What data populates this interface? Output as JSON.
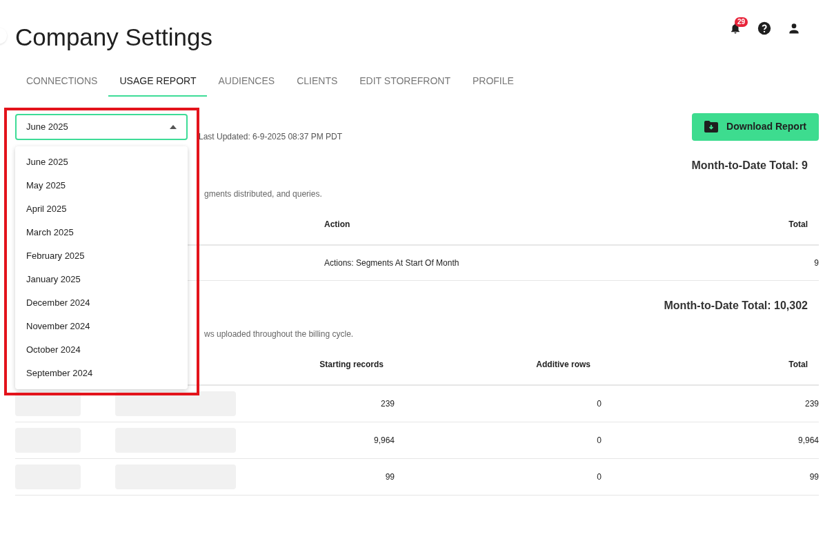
{
  "header": {
    "title": "Company Settings",
    "notifications": {
      "count": "29"
    }
  },
  "tabs": [
    {
      "label": "CONNECTIONS",
      "selected": false
    },
    {
      "label": "USAGE REPORT",
      "selected": true
    },
    {
      "label": "AUDIENCES",
      "selected": false
    },
    {
      "label": "CLIENTS",
      "selected": false
    },
    {
      "label": "EDIT STOREFRONT",
      "selected": false
    },
    {
      "label": "PROFILE",
      "selected": false
    }
  ],
  "month_select": {
    "value": "June 2025",
    "expanded": true,
    "options": [
      "June 2025",
      "May 2025",
      "April 2025",
      "March 2025",
      "February 2025",
      "January 2025",
      "December 2024",
      "November 2024",
      "October 2024",
      "September 2024"
    ]
  },
  "last_updated": "Last Updated: 6-9-2025 08:37 PM PDT",
  "download_button": "Download Report",
  "sections": [
    {
      "total": "Month-to-Date Total: 9",
      "description": "gments distributed, and queries.",
      "columns": [
        {},
        {
          "label": "Action"
        },
        {
          "label": "Total"
        }
      ],
      "rows": [
        [
          {
            "kind": "hidden"
          },
          {
            "kind": "text",
            "text": "Actions: Segments At Start Of Month"
          },
          {
            "kind": "text",
            "text": "9"
          }
        ]
      ]
    },
    {
      "total": "Month-to-Date Total: 10,302",
      "description": "ws uploaded throughout the billing cycle.",
      "columns": [
        {},
        {},
        {
          "label": "Starting records"
        },
        {
          "label": "Additive rows"
        },
        {
          "label": "Total"
        }
      ],
      "rows": [
        [
          {
            "kind": "redacted"
          },
          {
            "kind": "redacted"
          },
          {
            "kind": "text",
            "text": "239"
          },
          {
            "kind": "text",
            "text": "0"
          },
          {
            "kind": "text",
            "text": "239"
          }
        ],
        [
          {
            "kind": "redacted"
          },
          {
            "kind": "redacted"
          },
          {
            "kind": "text",
            "text": "9,964"
          },
          {
            "kind": "text",
            "text": "0"
          },
          {
            "kind": "text",
            "text": "9,964"
          }
        ],
        [
          {
            "kind": "redacted"
          },
          {
            "kind": "redacted"
          },
          {
            "kind": "text",
            "text": "99"
          },
          {
            "kind": "text",
            "text": "0"
          },
          {
            "kind": "text",
            "text": "99"
          }
        ]
      ]
    }
  ]
}
